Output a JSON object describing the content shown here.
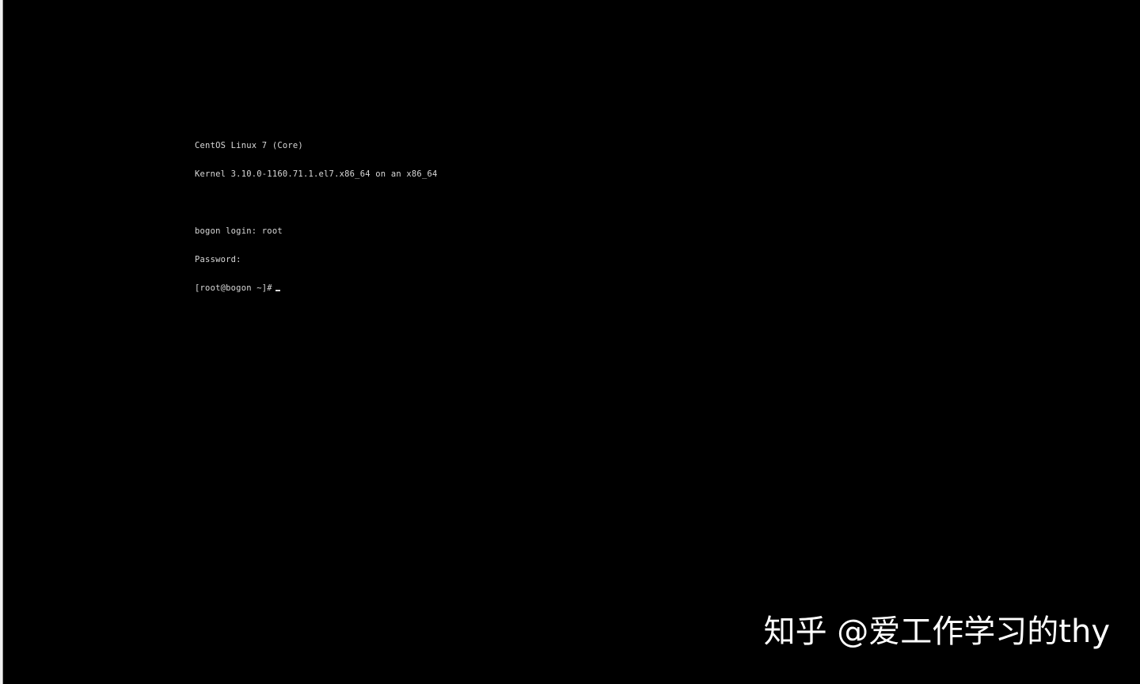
{
  "console": {
    "lines": [
      "CentOS Linux 7 (Core)",
      "Kernel 3.10.0-1160.71.1.el7.x86_64 on an x86_64",
      "",
      "bogon login: root",
      "Password:",
      "[root@bogon ~]#"
    ]
  },
  "watermark": {
    "text": "知乎 @爱工作学习的thy"
  }
}
